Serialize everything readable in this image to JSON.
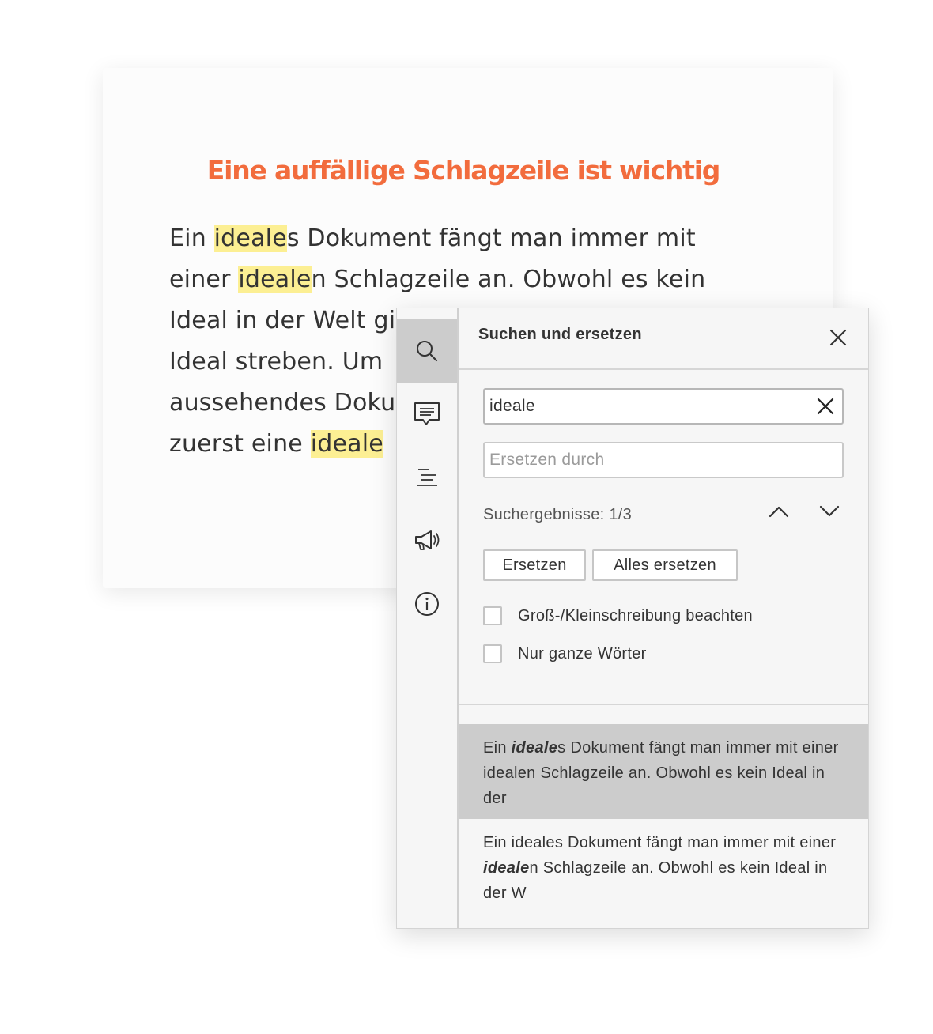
{
  "document": {
    "title": "Eine auffällige Schlagzeile ist wichtig",
    "lines": [
      {
        "before": "Ein ",
        "match": "ideale",
        "after": "s Dokument fängt man immer mit"
      },
      {
        "before": "einer ",
        "match": "ideale",
        "after": "n Schlagzeile an. Obwohl es kein"
      },
      {
        "text": "Ideal in der Welt gi"
      },
      {
        "text": "Ideal streben. Um"
      },
      {
        "text": "aussehendes Doku"
      },
      {
        "before": "zuerst eine ",
        "match": "ideale",
        "after": ""
      }
    ],
    "highlight_color": "#fcef93",
    "title_color": "#f26c3d"
  },
  "sidebar": {
    "items": [
      {
        "icon": "search-icon",
        "active": true
      },
      {
        "icon": "comment-icon",
        "active": false
      },
      {
        "icon": "outline-icon",
        "active": false
      },
      {
        "icon": "megaphone-icon",
        "active": false
      },
      {
        "icon": "info-icon",
        "active": false
      }
    ]
  },
  "search_panel": {
    "title": "Suchen und ersetzen",
    "search_value": "ideale",
    "replace_placeholder": "Ersetzen durch",
    "results_count": "Suchergebnisse: 1/3",
    "replace_label": "Ersetzen",
    "replace_all_label": "Alles ersetzen",
    "options": {
      "match_case": "Groß-/Kleinschreibung beachten",
      "whole_words": "Nur ganze Wörter"
    },
    "results": [
      {
        "before": "Ein ",
        "match": "ideale",
        "after": "s Dokument fängt man immer mit einer idealen Schlagzeile an. Obwohl es kein Ideal in der",
        "selected": true
      },
      {
        "before": "Ein ideales Dokument fängt man immer mit einer ",
        "match": "ideale",
        "after": "n Schlagzeile an. Obwohl es kein Ideal in der W",
        "selected": false
      }
    ],
    "selected_result_bg": "#cccccc"
  }
}
